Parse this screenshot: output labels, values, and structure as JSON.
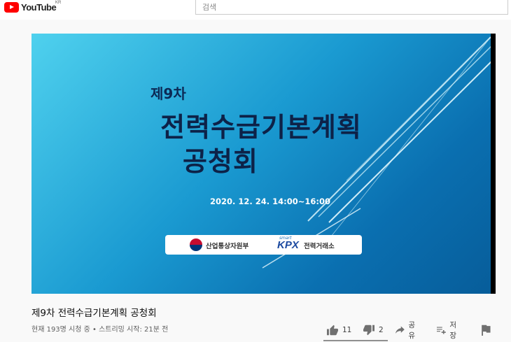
{
  "header": {
    "brand": "YouTube",
    "country_code": "KR",
    "search_placeholder": "검색"
  },
  "slide": {
    "edition": "제9차",
    "title_line1": "전력수급기본계획",
    "title_line2": "공청회",
    "date": "2020. 12. 24. 14:00~16:00",
    "org_left": "산업통상자원부",
    "org_right_small": "smart",
    "org_right_brand": "KPX",
    "org_right_name": "전력거래소"
  },
  "video": {
    "title": "제9차 전력수급기본계획 공청회",
    "meta": "현재 193명 시청 중 • 스트리밍 시작: 21분 전"
  },
  "actions": {
    "likes": "11",
    "dislikes": "2",
    "share_label": "공유",
    "save_label": "저장"
  },
  "colors": {
    "brand_red": "#ff0000",
    "slide_top": "#4fd1ee",
    "slide_bottom": "#075d9a"
  }
}
